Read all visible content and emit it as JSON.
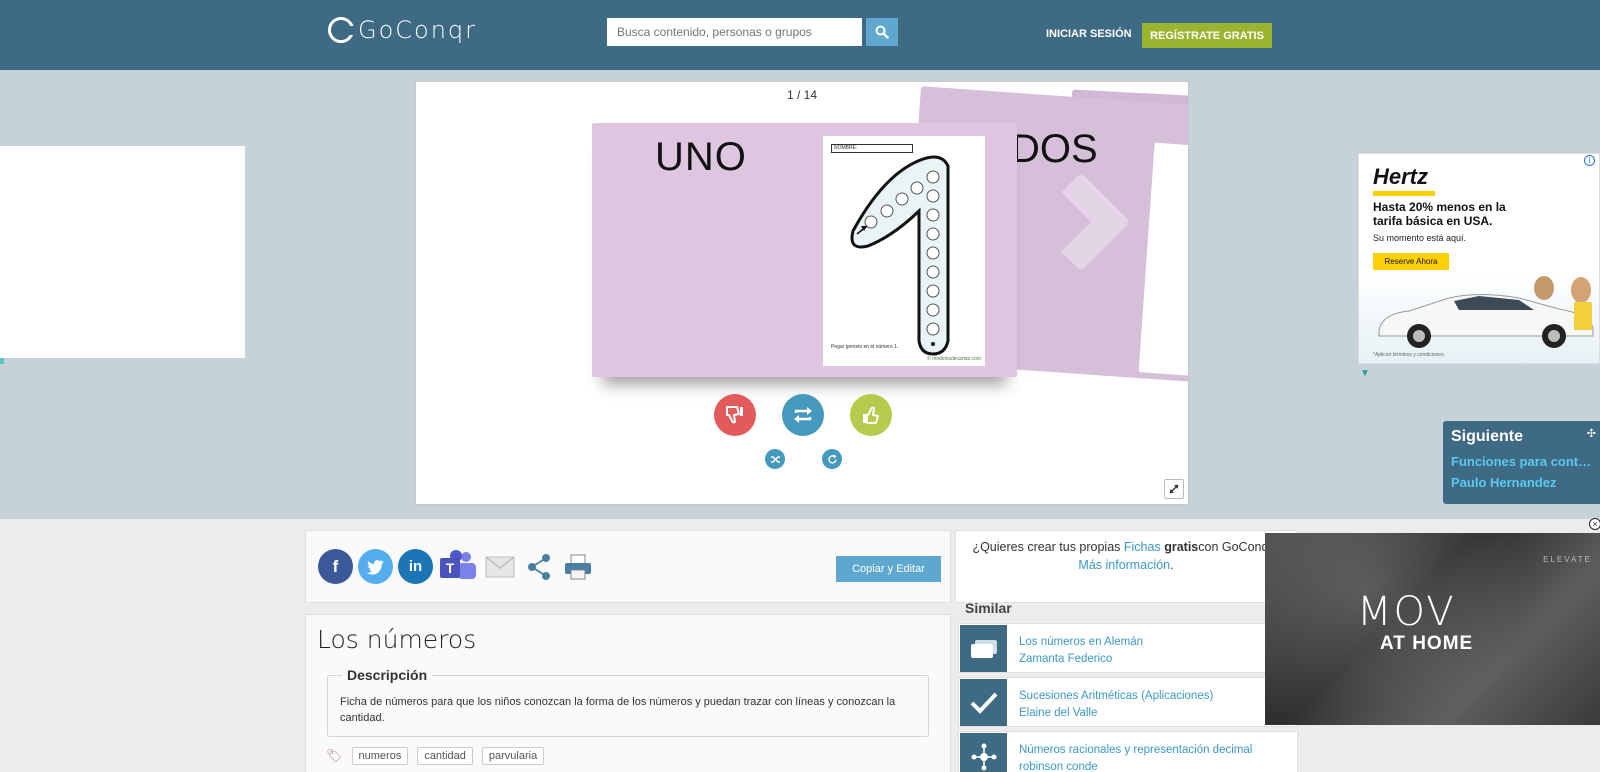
{
  "header": {
    "logo_text": "GoConqr",
    "search_placeholder": "Busca contenido, personas o grupos",
    "login_label": "INICIAR SESIÓN",
    "signup_label": "REGÍSTRATE GRATIS"
  },
  "viewer": {
    "counter": "1 / 14",
    "front_card_word": "UNO",
    "next_card_word": "DOS",
    "worksheet_name_label": "NOMBRE:",
    "worksheet_caption": "Pegar gomets en el número 1.",
    "worksheet_credit": "© modelosdecartas.com"
  },
  "hertz_ad": {
    "brand": "Hertz",
    "headline": "Hasta 20% menos en la tarifa básica en USA.",
    "subline": "Su momento está aquí.",
    "cta": "Reserve Ahora",
    "fine_print": "*Aplican términos y condiciones.",
    "info_icon": "i",
    "accent_color": "#ffd000"
  },
  "next_panel": {
    "title": "Siguiente",
    "link": "Funciones para conta...",
    "author": "Paulo Hernandez"
  },
  "share": {
    "facebook": "f",
    "linkedin": "in",
    "copy_edit_label": "Copiar y Editar"
  },
  "resource": {
    "title": "Los números",
    "description_heading": "Descripción",
    "description": "Ficha de números para que los niños conozcan la forma de los números y puedan trazar con líneas y conozcan la cantidad.",
    "tags": [
      "numeros",
      "cantidad",
      "parvularia"
    ]
  },
  "promo": {
    "lead": "¿Quieres crear tus propias ",
    "link_fichas": "Fichas",
    "gratis": "gratis",
    "tail": "con GoConqr?",
    "more_link": "Más información",
    "period": "."
  },
  "similar": {
    "heading": "Similar",
    "items": [
      {
        "title": "Los números en Alemán",
        "author": "Zamanta Federico",
        "icon": "cards-icon"
      },
      {
        "title": "Sucesiones Aritméticas (Aplicaciones)",
        "author": "Elaine del Valle",
        "icon": "check-icon"
      },
      {
        "title": "Números racionales y representación decimal",
        "author": "robinson conde",
        "icon": "mindmap-icon"
      }
    ]
  },
  "video_ad": {
    "headline": "MOV",
    "subheadline": "AT HOME",
    "backdrop_text": "ELEVATE",
    "close_label": "×"
  },
  "colors": {
    "header": "#3f6a84",
    "hero": "#c5d3d9",
    "signup": "#99b530",
    "link": "#3a97c4",
    "dislike": "#e35a5a",
    "repeat": "#4599bd",
    "like": "#b6cb4d"
  }
}
